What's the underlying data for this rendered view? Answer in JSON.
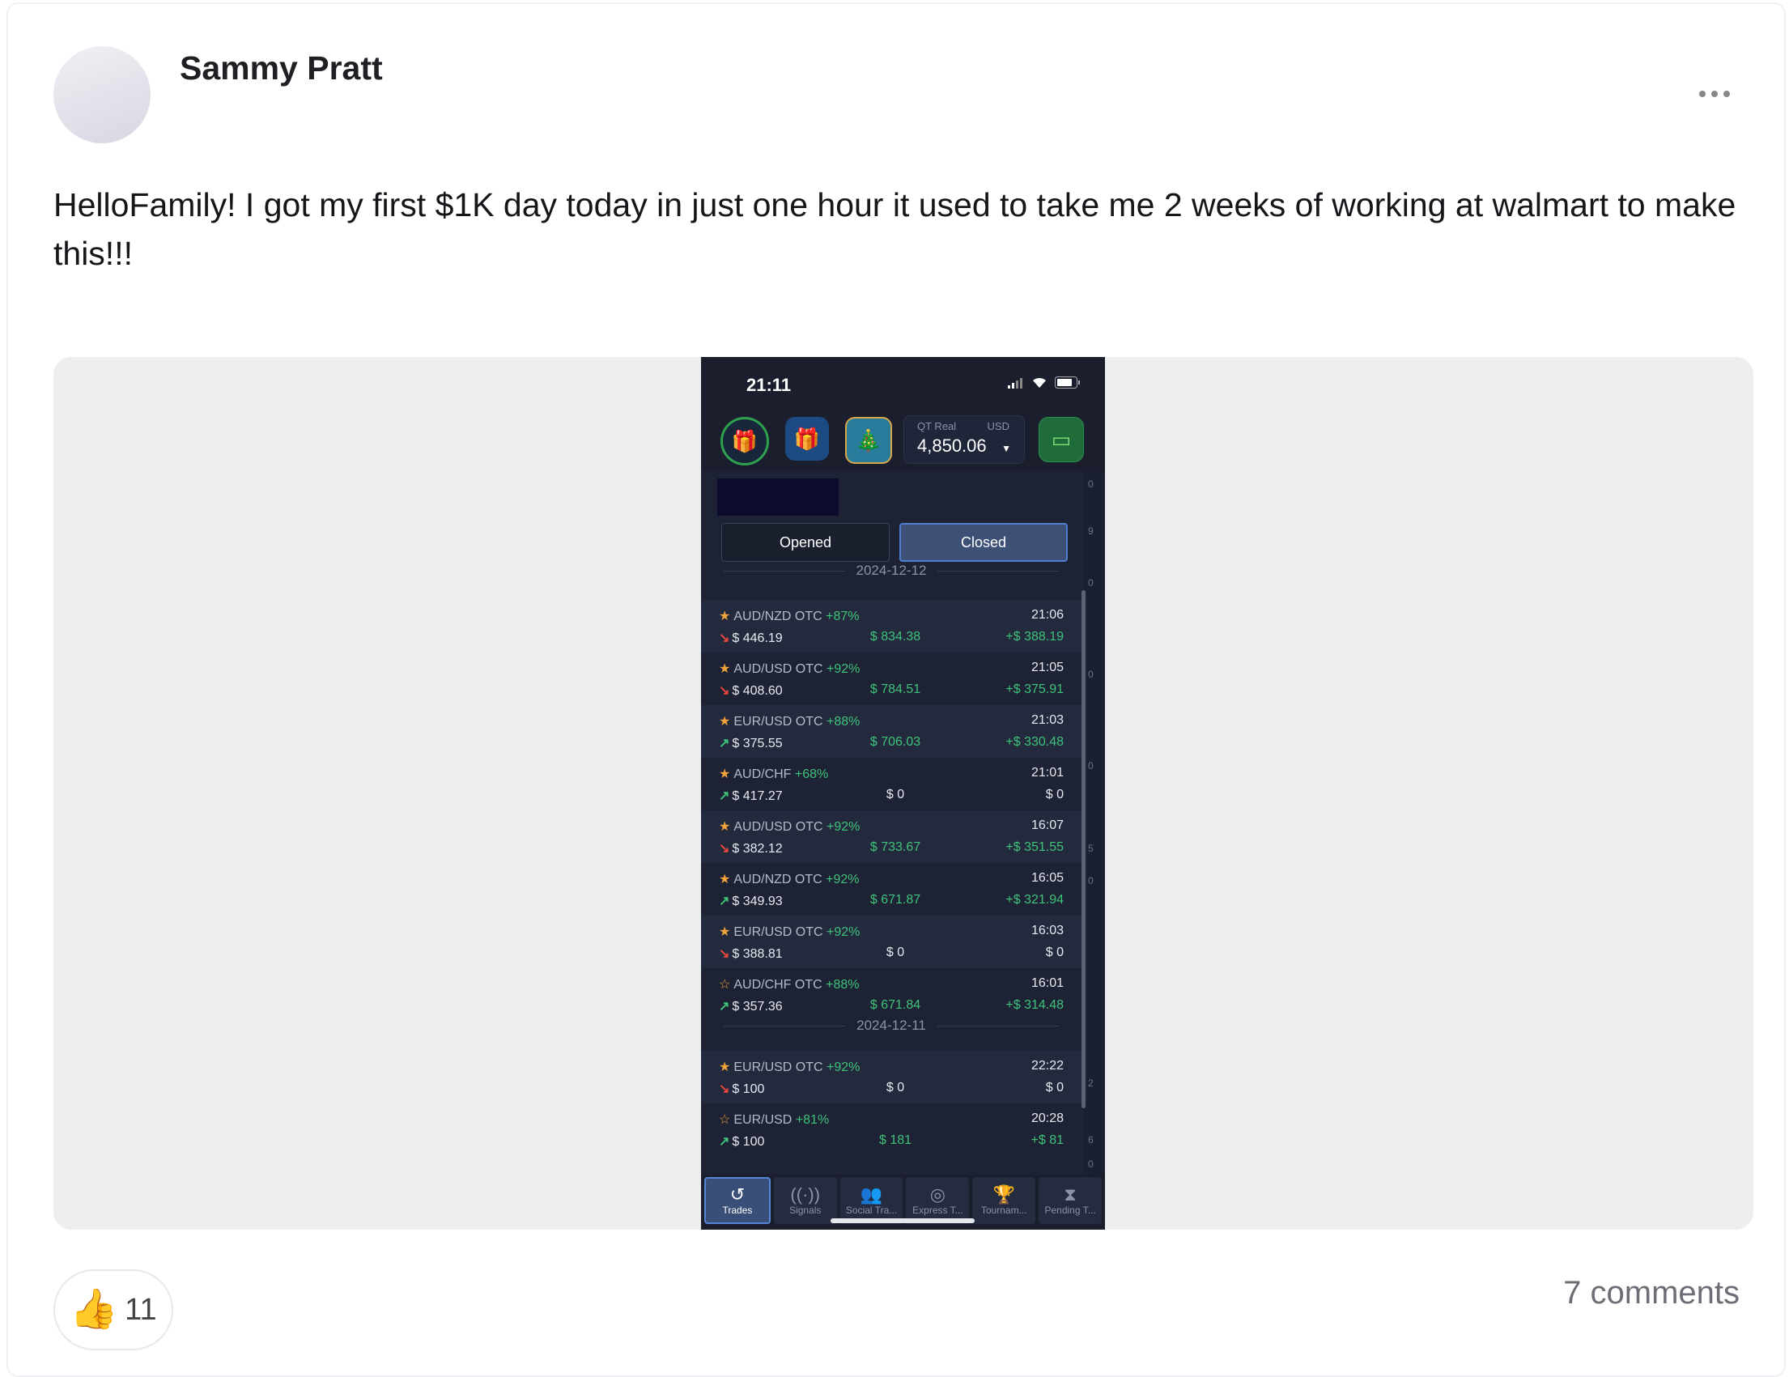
{
  "post": {
    "author": "Sammy Pratt",
    "text": "HelloFamily! I got my first $1K day today in just one hour it used to take me 2 weeks of working at walmart to make this!!!",
    "reactions": {
      "emoji": "👍",
      "count": "11"
    },
    "comments": "7 comments"
  },
  "phone": {
    "time": "21:11",
    "account": {
      "label": "QT Real",
      "currency": "USD",
      "balance": "4,850.06"
    },
    "tabs": {
      "opened": "Opened",
      "closed": "Closed"
    },
    "side_digits": [
      "0",
      "9",
      "0",
      "0",
      "0",
      "5",
      "0",
      "2",
      "6",
      "0"
    ],
    "dates": [
      "2024-12-12",
      "2024-12-11"
    ],
    "trades": [
      {
        "pair": "AUD/NZD OTC",
        "pct": "+87%",
        "time": "21:06",
        "amount": "$ 446.19",
        "dir": "down",
        "payout": "$ 834.38",
        "profit": "+$ 388.19",
        "star": "filled"
      },
      {
        "pair": "AUD/USD OTC",
        "pct": "+92%",
        "time": "21:05",
        "amount": "$ 408.60",
        "dir": "down",
        "payout": "$ 784.51",
        "profit": "+$ 375.91",
        "star": "filled"
      },
      {
        "pair": "EUR/USD OTC",
        "pct": "+88%",
        "time": "21:03",
        "amount": "$ 375.55",
        "dir": "up",
        "payout": "$ 706.03",
        "profit": "+$ 330.48",
        "star": "filled"
      },
      {
        "pair": "AUD/CHF",
        "pct": "+68%",
        "time": "21:01",
        "amount": "$ 417.27",
        "dir": "up",
        "payout": "$ 0",
        "profit": "$ 0",
        "star": "filled"
      },
      {
        "pair": "AUD/USD OTC",
        "pct": "+92%",
        "time": "16:07",
        "amount": "$ 382.12",
        "dir": "down",
        "payout": "$ 733.67",
        "profit": "+$ 351.55",
        "star": "filled"
      },
      {
        "pair": "AUD/NZD OTC",
        "pct": "+92%",
        "time": "16:05",
        "amount": "$ 349.93",
        "dir": "up",
        "payout": "$ 671.87",
        "profit": "+$ 321.94",
        "star": "filled"
      },
      {
        "pair": "EUR/USD OTC",
        "pct": "+92%",
        "time": "16:03",
        "amount": "$ 388.81",
        "dir": "down",
        "payout": "$ 0",
        "profit": "$ 0",
        "star": "filled"
      },
      {
        "pair": "AUD/CHF OTC",
        "pct": "+88%",
        "time": "16:01",
        "amount": "$ 357.36",
        "dir": "up",
        "payout": "$ 671.84",
        "profit": "+$ 314.48",
        "star": "outline"
      },
      {
        "pair": "EUR/USD OTC",
        "pct": "+92%",
        "time": "22:22",
        "amount": "$ 100",
        "dir": "down",
        "payout": "$ 0",
        "profit": "$ 0",
        "star": "filled"
      },
      {
        "pair": "EUR/USD",
        "pct": "+81%",
        "time": "20:28",
        "amount": "$ 100",
        "dir": "up",
        "payout": "$ 181",
        "profit": "+$ 81",
        "star": "outline"
      }
    ],
    "nav": [
      "Trades",
      "Signals",
      "Social Tra...",
      "Express T...",
      "Tournam...",
      "Pending T..."
    ],
    "colors": {
      "profit": "#3fc27a",
      "loss_arrow": "#e9483b",
      "star": "#f0a33a",
      "active_tab": "#4f7ed1"
    }
  }
}
